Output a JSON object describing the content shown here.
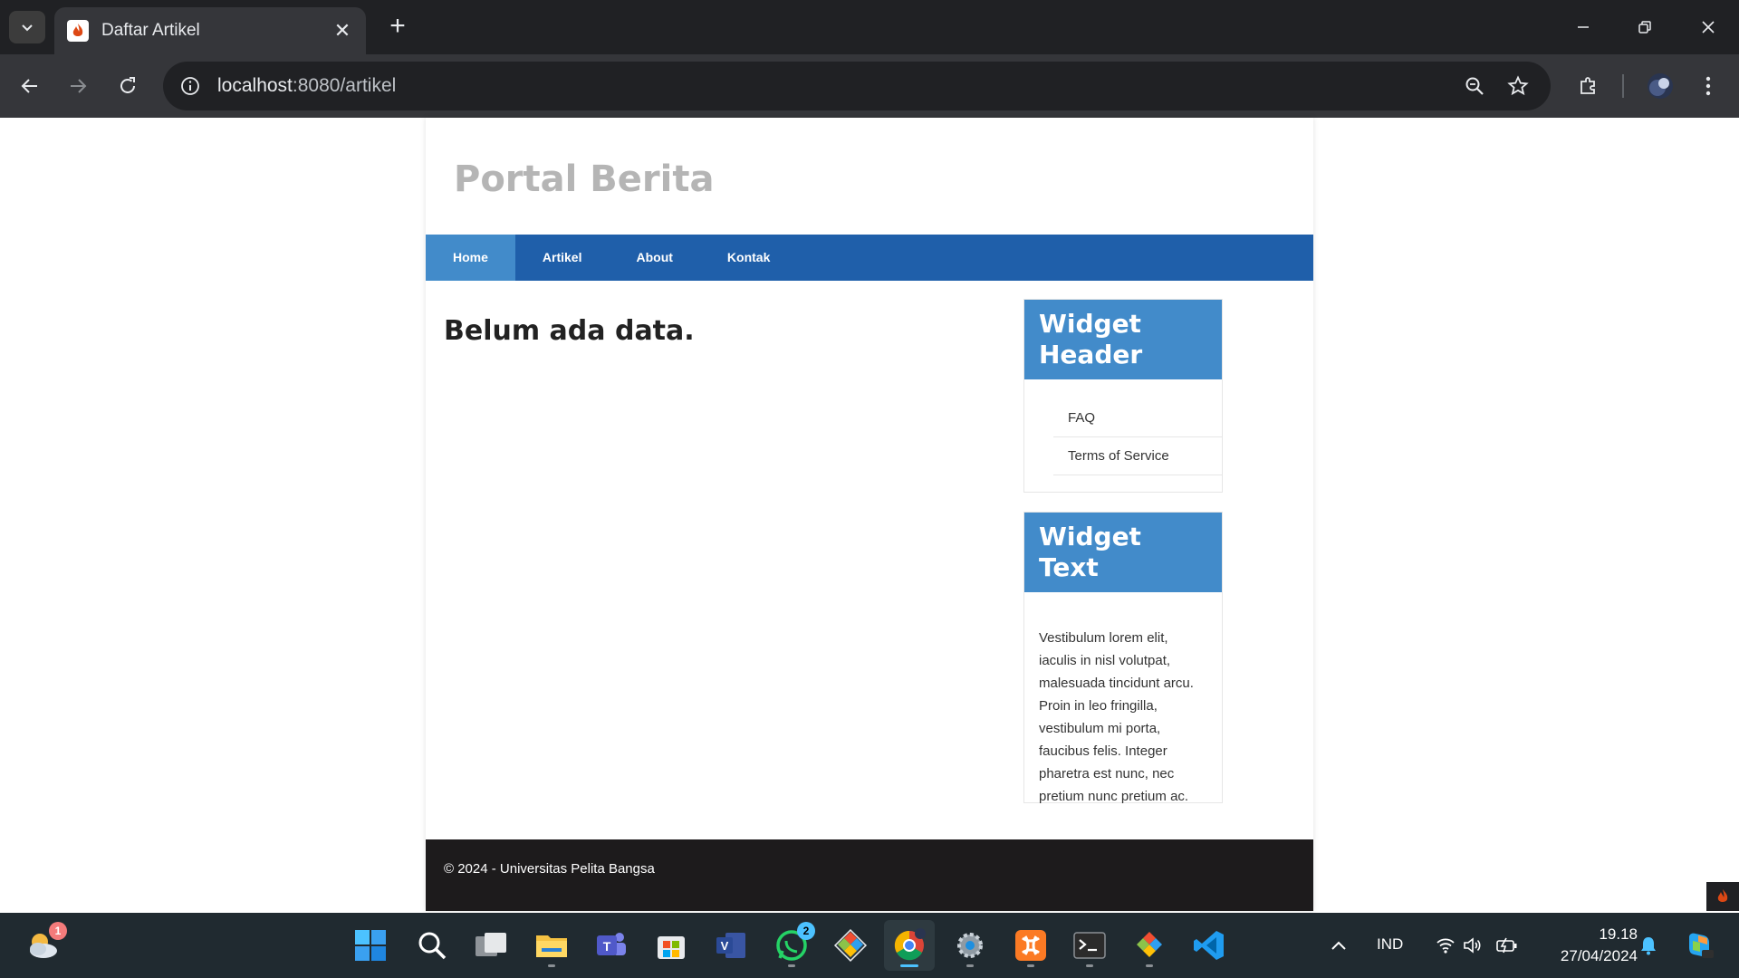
{
  "browser": {
    "tab_title": "Daftar Artikel",
    "tab_close_glyph": "✕",
    "new_tab_glyph": "+",
    "url_host": "localhost",
    "url_rest": ":8080/artikel"
  },
  "site": {
    "title": "Portal Berita",
    "nav": [
      {
        "label": "Home",
        "active": true
      },
      {
        "label": "Artikel",
        "active": false
      },
      {
        "label": "About",
        "active": false
      },
      {
        "label": "Kontak",
        "active": false
      }
    ],
    "main_message": "Belum ada data.",
    "widget_header": {
      "title": "Widget Header",
      "items": [
        "FAQ",
        "Terms of Service"
      ]
    },
    "widget_text": {
      "title": "Widget Text",
      "body": "Vestibulum lorem elit, iaculis in nisl volutpat, malesuada tincidunt arcu. Proin in leo fringilla, vestibulum mi porta, faucibus felis. Integer pharetra est nunc, nec pretium nunc pretium ac."
    },
    "footer": "© 2024 - Universitas Pelita Bangsa"
  },
  "taskbar": {
    "weather_badge": "1",
    "whatsapp_badge": "2",
    "language": "IND",
    "time": "19.18",
    "date": "27/04/2024",
    "apps": [
      "start-icon",
      "search-icon",
      "task-view-icon",
      "file-explorer-icon",
      "teams-icon",
      "store-icon",
      "visio-icon",
      "whatsapp-icon",
      "git-icon",
      "chrome-icon",
      "settings-icon",
      "xampp-icon",
      "terminal-icon",
      "git-gui-icon",
      "vscode-icon"
    ]
  },
  "colors": {
    "nav_bg": "#1f5faa",
    "nav_active": "#428bca",
    "widget_title_bg": "#428bca",
    "footer_bg": "#1d1b1c",
    "site_title": "#b5b5b5"
  }
}
